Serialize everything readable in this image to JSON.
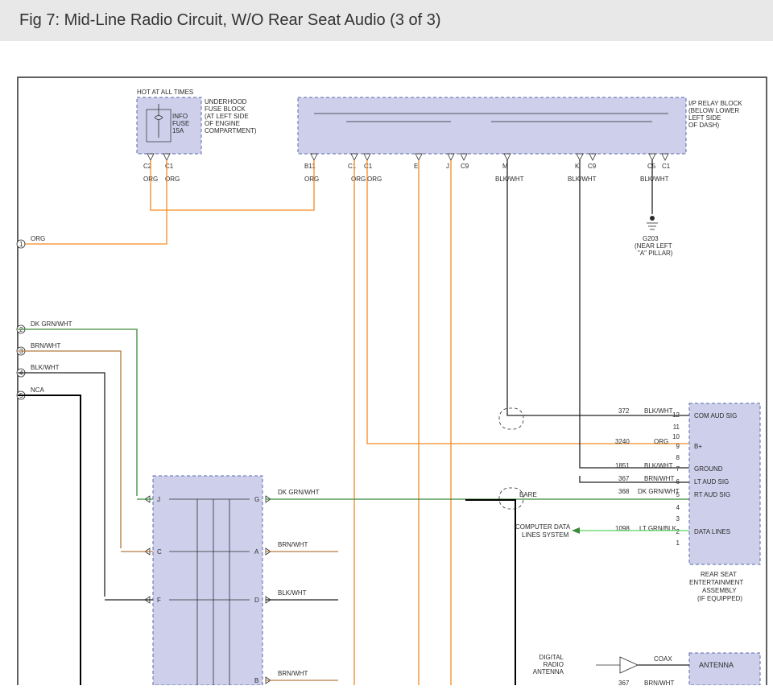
{
  "header": {
    "title": "Fig 7: Mid-Line Radio Circuit, W/O Rear Seat Audio (3 of 3)"
  },
  "labels": {
    "hot": "HOT AT ALL TIMES",
    "fuse": {
      "l1": "INFO",
      "l2": "FUSE",
      "l3": "15A"
    },
    "underhood": {
      "l1": "UNDERHOOD",
      "l2": "FUSE BLOCK",
      "l3": "(AT LEFT SIDE",
      "l4": "OF ENGINE",
      "l5": "COMPARTMENT)"
    },
    "iprelay": {
      "l1": "I/P RELAY BLOCK",
      "l2": "(BELOW LOWER",
      "l3": "LEFT SIDE",
      "l4": "OF DASH)"
    },
    "g203": {
      "l1": "G203",
      "l2": "(NEAR LEFT",
      "l3": "\"A\" PILLAR)"
    },
    "pins": {
      "c2": "C2",
      "c1": "C1",
      "b11": "B11",
      "e": "E",
      "j": "J",
      "c9a": "C9",
      "m": "M",
      "k": "K",
      "c5": "C5",
      "cJ": "J",
      "cC": "C",
      "cF": "F",
      "cG": "G",
      "cA": "A",
      "cD": "D",
      "cB": "B"
    },
    "wirecolor": {
      "org": "ORG",
      "blkwht": "BLK/WHT",
      "dkgrn": "DK GRN/WHT",
      "brnwht": "BRN/WHT",
      "nca": "NCA",
      "bare": "BARE",
      "ltgrnblk": "LT GRN/BLK",
      "coax": "COAX"
    },
    "leftnums": {
      "n1": "1",
      "n2": "2",
      "n3": "3",
      "n4": "4",
      "n5": "5"
    },
    "rseBlock": {
      "title1": "REAR SEAT",
      "title2": "ENTERTAINMENT",
      "title3": "ASSEMBLY",
      "title4": "(IF EQUIPPED)",
      "p12": "12",
      "p11": "11",
      "p10": "10",
      "p9": "9",
      "p8": "8",
      "p7": "7",
      "p6": "6",
      "p5": "5",
      "p4": "4",
      "p3": "3",
      "p2": "2",
      "p1": "1",
      "sig1": "COM AUD SIG",
      "sig2": "B+",
      "sig3": "GROUND",
      "sig4": "LT AUD SIG",
      "sig5": "RT AUD SIG",
      "sig6": "DATA LINES"
    },
    "circuitNums": {
      "c372": "372",
      "c3240": "3240",
      "c1851": "1851",
      "c367": "367",
      "c368": "368",
      "c1098": "1098",
      "c367b": "367"
    },
    "cdl": {
      "l1": "COMPUTER DATA",
      "l2": "LINES SYSTEM"
    },
    "antenna": {
      "dig1": "DIGITAL",
      "dig2": "RADIO",
      "dig3": "ANTENNA",
      "ant": "ANTENNA"
    }
  }
}
